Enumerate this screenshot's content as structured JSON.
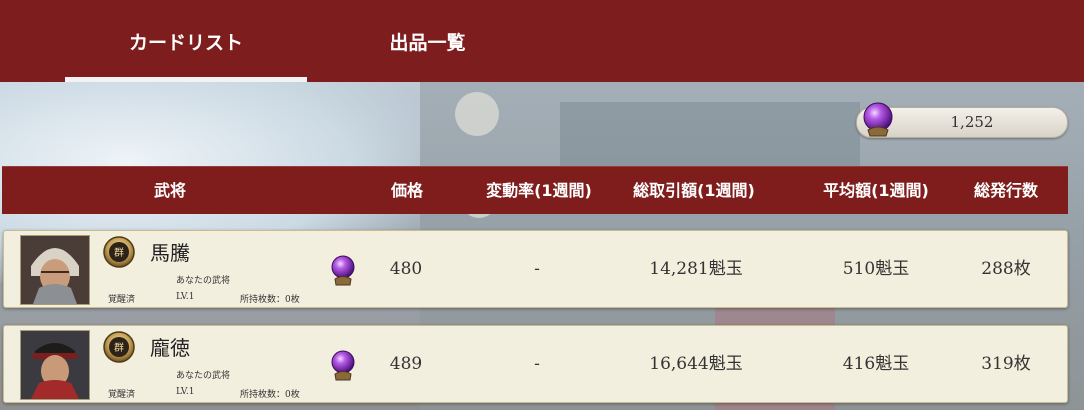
{
  "nav": {
    "tabs": [
      {
        "label": "カードリスト",
        "active": true
      },
      {
        "label": "出品一覧",
        "active": false
      }
    ]
  },
  "balance": {
    "amount": "1,252",
    "icon": "purple-orb-icon"
  },
  "table": {
    "headers": [
      "武将",
      "価格",
      "変動率(1週間)",
      "総取引額(1週間)",
      "平均額(1週間)",
      "総発行数"
    ],
    "rows": [
      {
        "name": "馬騰",
        "badge": "群",
        "owner": "あなたの武将",
        "awakened": "覚醒済",
        "level": "LV.1",
        "held": "所持枚数：0枚",
        "price": "480",
        "change": "-",
        "total": "14,281魁玉",
        "average": "510魁玉",
        "issued": "288枚"
      },
      {
        "name": "龐徳",
        "badge": "群",
        "owner": "あなたの武将",
        "awakened": "覚醒済",
        "level": "LV.1",
        "held": "所持枚数：0枚",
        "price": "489",
        "change": "-",
        "total": "16,644魁玉",
        "average": "416魁玉",
        "issued": "319枚"
      }
    ]
  },
  "colors": {
    "header": "#7f1d1d",
    "row_bg": "#f3efde",
    "orb": "#9b3fd1"
  }
}
